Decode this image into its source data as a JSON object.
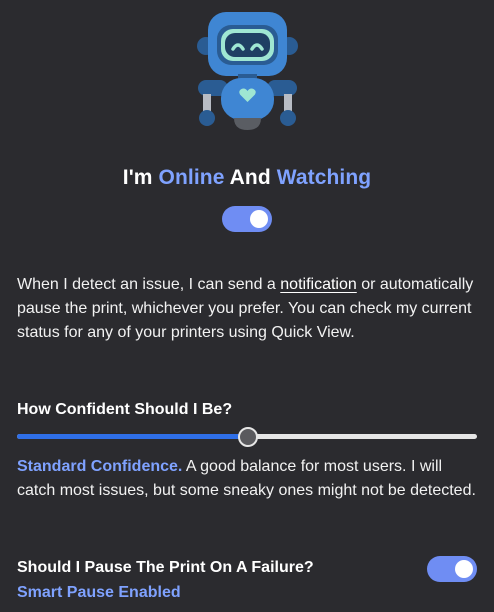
{
  "hero": {
    "title_prefix": "I'm ",
    "title_online": "Online",
    "title_and": " And ",
    "title_watching": "Watching",
    "watching_enabled": true
  },
  "description": {
    "part1": "When I detect an issue, I can send a ",
    "notification_link": "notification",
    "part2": " or automatically pause the print, whichever you prefer. You can check my current status for any of your printers using Quick View."
  },
  "confidence": {
    "label": "How Confident Should I Be?",
    "level_fraction": 0.5,
    "level_name": "Standard Confidence.",
    "level_description": " A good balance for most users. I will catch most issues, but some sneaky ones might not be detected."
  },
  "pause": {
    "label": "Should I Pause The Print On A Failure?",
    "status": "Smart Pause Enabled",
    "enabled": true
  },
  "colors": {
    "background": "#2b2b2f",
    "accent": "#7fa2ff",
    "toggle": "#6f8df3",
    "slider_fill": "#2f6fe8",
    "robot_blue": "#3f86d3",
    "robot_dark": "#2a5c93",
    "robot_screen": "#9fe6d2"
  },
  "icons": {
    "robot": "robot-mascot-icon"
  }
}
